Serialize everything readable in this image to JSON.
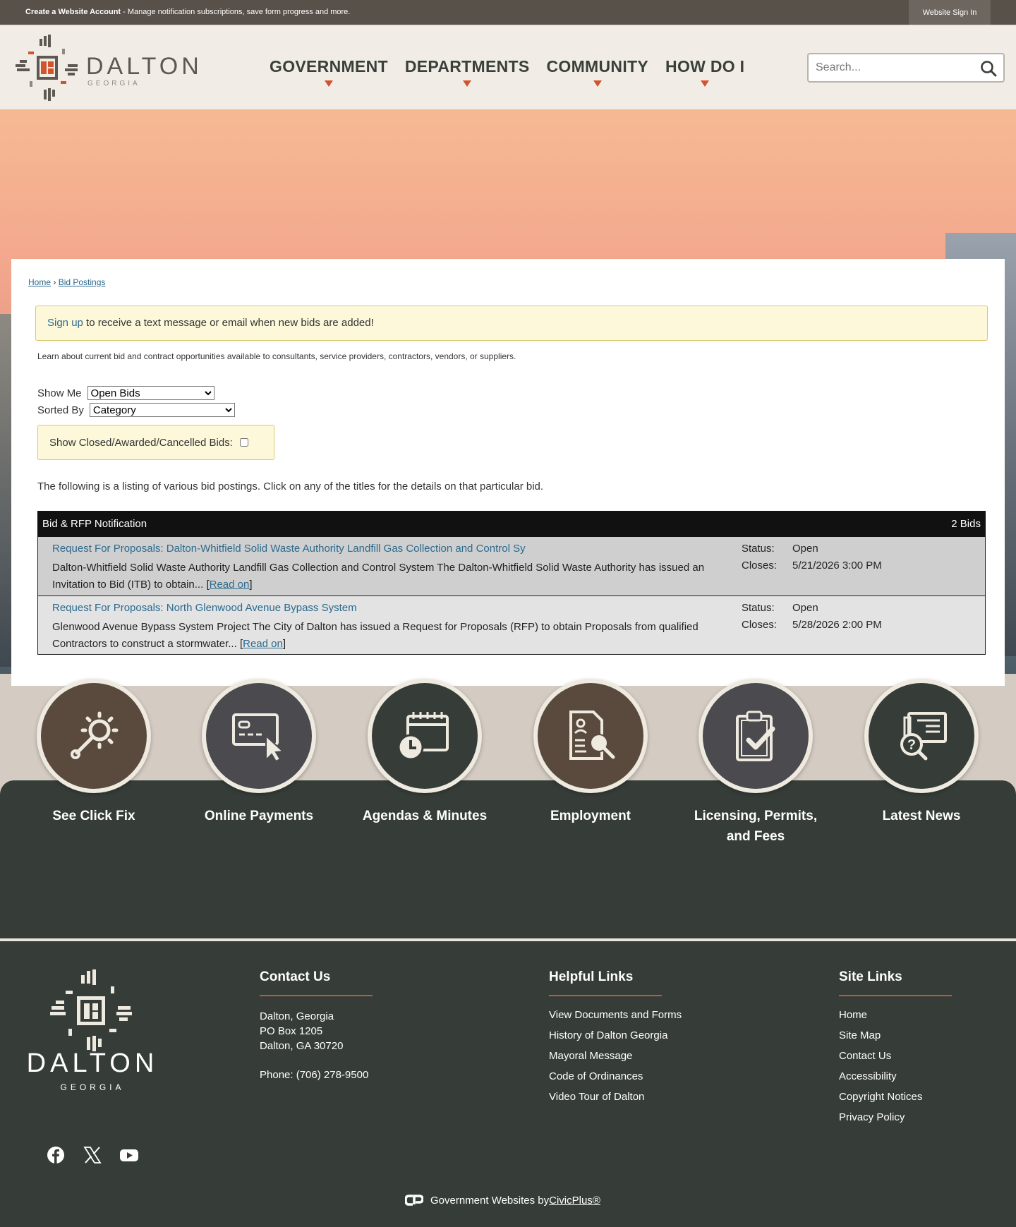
{
  "topbar": {
    "create_account": "Create a Website Account",
    "create_account_desc": " - Manage notification subscriptions, save form progress and more.",
    "signin": "Website Sign In"
  },
  "logo": {
    "word": "DALTON",
    "sub": "GEORGIA"
  },
  "nav": {
    "items": [
      {
        "label": "GOVERNMENT"
      },
      {
        "label": "DEPARTMENTS"
      },
      {
        "label": "COMMUNITY"
      },
      {
        "label": "HOW DO I"
      }
    ]
  },
  "search": {
    "placeholder": "Search..."
  },
  "breadcrumb": {
    "home": "Home",
    "sep": "›",
    "current": "Bid Postings"
  },
  "notice": {
    "link": "Sign up",
    "text": " to receive a text message or email when new bids are added!"
  },
  "intro": "Learn about current bid and contract opportunities available to consultants, service providers, contractors, vendors, or suppliers.",
  "filters": {
    "show_me_label": "Show Me",
    "show_me_value": "Open Bids",
    "sorted_by_label": "Sorted By",
    "sorted_by_value": "Category",
    "closed_label": "Show Closed/Awarded/Cancelled Bids:"
  },
  "listing_text": "The following is a listing of various bid postings. Click on any of the titles for the details on that particular bid.",
  "bids": {
    "header": "Bid & RFP Notification",
    "count": "2 Bids",
    "status_label": "Status:",
    "closes_label": "Closes:",
    "read_on": "Read on",
    "items": [
      {
        "title": "Request For Proposals: Dalton-Whitfield Solid Waste Authority Landfill Gas Collection and Control Sy",
        "desc": "Dalton-Whitfield Solid Waste Authority Landfill Gas Collection and Control System The Dalton-Whitfield Solid Waste Authority has issued an Invitation to Bid (ITB) to obtain... ",
        "status": "Open",
        "closes": "5/21/2026 3:00 PM"
      },
      {
        "title": "Request For Proposals: North Glenwood Avenue Bypass System",
        "desc": "Glenwood Avenue Bypass System Project The City of Dalton has issued a Request for Proposals (RFP) to obtain Proposals from qualified Contractors to construct a stormwater... ",
        "status": "Open",
        "closes": "5/28/2026 2:00 PM"
      }
    ]
  },
  "quick_links": [
    {
      "label": "See Click Fix",
      "icon": "wrench-gear-icon",
      "bg": "#5a4a3e"
    },
    {
      "label": "Online Payments",
      "icon": "card-cursor-icon",
      "bg": "#4a4a4f"
    },
    {
      "label": "Agendas & Minutes",
      "icon": "calendar-clock-icon",
      "bg": "#363d38"
    },
    {
      "label": "Employment",
      "icon": "document-search-icon",
      "bg": "#5a4a3e"
    },
    {
      "label": "Licensing, Permits, and Fees",
      "icon": "clipboard-check-icon",
      "bg": "#4a4a4f"
    },
    {
      "label": "Latest News",
      "icon": "newspaper-question-icon",
      "bg": "#363d38"
    }
  ],
  "footer": {
    "logo_word": "DALTON",
    "logo_sub": "GEORGIA",
    "contact": {
      "heading": "Contact Us",
      "line1": "Dalton, Georgia",
      "line2": "PO Box 1205",
      "line3": "Dalton, GA 30720",
      "phone": "Phone: (706) 278-9500"
    },
    "helpful": {
      "heading": "Helpful Links",
      "links": [
        "View Documents and Forms",
        "History of Dalton Georgia",
        "Mayoral Message",
        "Code of Ordinances",
        "Video Tour of Dalton"
      ]
    },
    "site": {
      "heading": "Site Links",
      "links": [
        "Home",
        "Site Map",
        "Contact Us",
        "Accessibility",
        "Copyright Notices",
        "Privacy Policy"
      ]
    },
    "civic_text": "Government Websites by ",
    "civic_link": "CivicPlus®"
  },
  "colors": {
    "accent": "#d3532e",
    "link": "#2b6a8e",
    "dark": "#363d38",
    "notice_bg": "#fcf8d9"
  }
}
